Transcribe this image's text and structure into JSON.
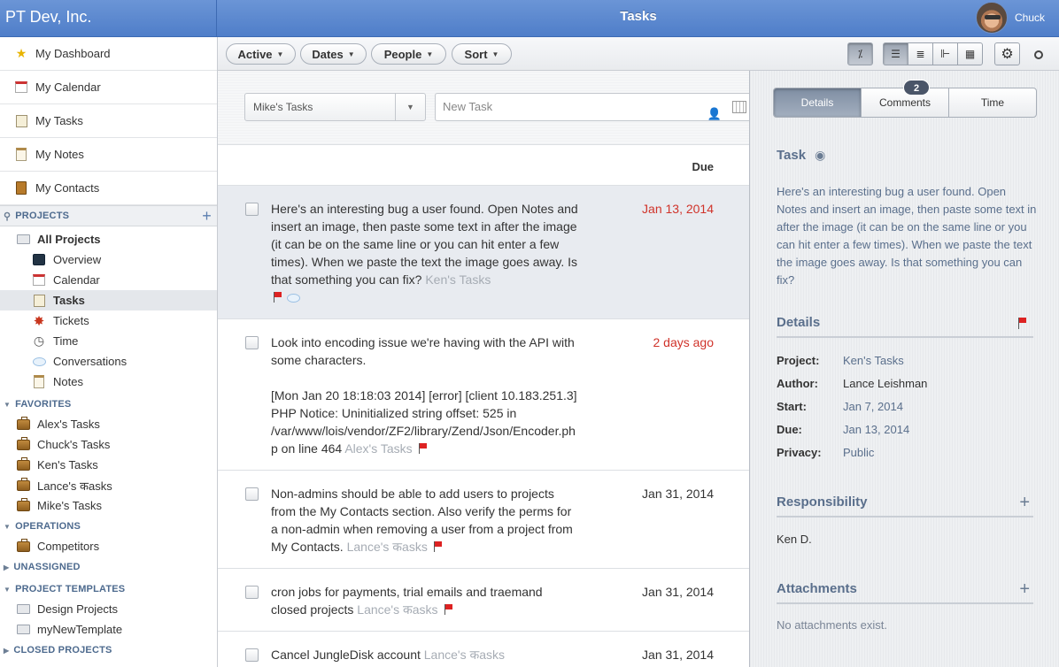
{
  "topbar": {
    "company": "PT Dev, Inc.",
    "title": "Tasks",
    "user": "Chuck"
  },
  "sidebar": {
    "top": [
      {
        "label": "My Dashboard",
        "icon": "star-icon"
      },
      {
        "label": "My Calendar",
        "icon": "calendar-icon"
      },
      {
        "label": "My Tasks",
        "icon": "checklist-icon"
      },
      {
        "label": "My Notes",
        "icon": "notes-icon"
      },
      {
        "label": "My Contacts",
        "icon": "contacts-icon"
      }
    ],
    "projects_header": "PROJECTS",
    "all_projects": "All Projects",
    "project_items": [
      {
        "label": "Overview"
      },
      {
        "label": "Calendar"
      },
      {
        "label": "Tasks"
      },
      {
        "label": "Tickets"
      },
      {
        "label": "Time"
      },
      {
        "label": "Conversations"
      },
      {
        "label": "Notes"
      }
    ],
    "favorites_header": "FAVORITES",
    "favorites": [
      "Alex's Tasks",
      "Chuck's Tasks",
      "Ken's Tasks",
      "Lance's कasks",
      "Mike's Tasks"
    ],
    "operations_header": "OPERATIONS",
    "operations": [
      "Competitors"
    ],
    "unassigned_header": "UNASSIGNED",
    "templates_header": "PROJECT TEMPLATES",
    "templates": [
      "Design Projects",
      "myNewTemplate"
    ],
    "closed_header": "CLOSED PROJECTS"
  },
  "toolbar": {
    "filters": [
      "Active",
      "Dates",
      "People",
      "Sort"
    ],
    "view_buttons": [
      "percent-icon",
      "list-comfortable-icon",
      "list-compact-icon",
      "gantt-icon",
      "grid-icon"
    ],
    "settings_icon": "gear-icon",
    "search_icon": "search-icon"
  },
  "list": {
    "task_selector": "Mike's Tasks",
    "new_task_placeholder": "New Task",
    "due_header": "Due",
    "tasks": [
      {
        "text": "Here's an interesting bug a user found. Open Notes and insert an image, then paste some text in after the image (it can be on the same line or you can hit enter a few times). When we paste the text the image goes away. Is that something you can fix?",
        "project": "Ken's Tasks",
        "due": "Jan 13, 2014",
        "due_color": "#d0332a"
      },
      {
        "text": "Look into encoding issue we're having with the API with some characters.",
        "text2": "[Mon Jan 20 18:18:03 2014] [error] [client 10.183.251.3] PHP Notice: Uninitialized string offset: 525 in /var/www/lois/vendor/ZF2/library/Zend/Json/Encoder.ph p on line 464",
        "project": "Alex's Tasks",
        "due": "2 days ago",
        "due_color": "#d0332a"
      },
      {
        "text": "Non-admins should be able to add users to projects from the My Contacts section. Also verify the perms for a non-admin when removing a user from a project from My Contacts.",
        "project": "Lance's कasks",
        "due": "Jan 31, 2014"
      },
      {
        "text": "cron jobs for payments, trial emails and traemand closed projects",
        "project": "Lance's कasks",
        "due": "Jan 31, 2014"
      },
      {
        "text": "Cancel JungleDisk account",
        "project": "Lance's कasks",
        "due": "Jan 31, 2014"
      }
    ]
  },
  "detail": {
    "tabs": [
      "Details",
      "Comments",
      "Time"
    ],
    "comments_count": "2",
    "task_header": "Task",
    "task_text": "Here's an interesting bug a user found. Open Notes and insert an image, then paste some text in after the image (it can be on the same line or you can hit enter a few times). When we paste the text the image goes away. Is that something you can fix?",
    "details_header": "Details",
    "fields": [
      {
        "key": "Project:",
        "value": "Ken's Tasks"
      },
      {
        "key": "Author:",
        "value": "Lance Leishman"
      },
      {
        "key": "Start:",
        "value": "Jan 7, 2014"
      },
      {
        "key": "Due:",
        "value": "Jan 13, 2014"
      },
      {
        "key": "Privacy:",
        "value": "Public"
      }
    ],
    "responsibility_header": "Responsibility",
    "responsible": "Ken D.",
    "attachments_header": "Attachments",
    "attachments_empty": "No attachments exist."
  }
}
